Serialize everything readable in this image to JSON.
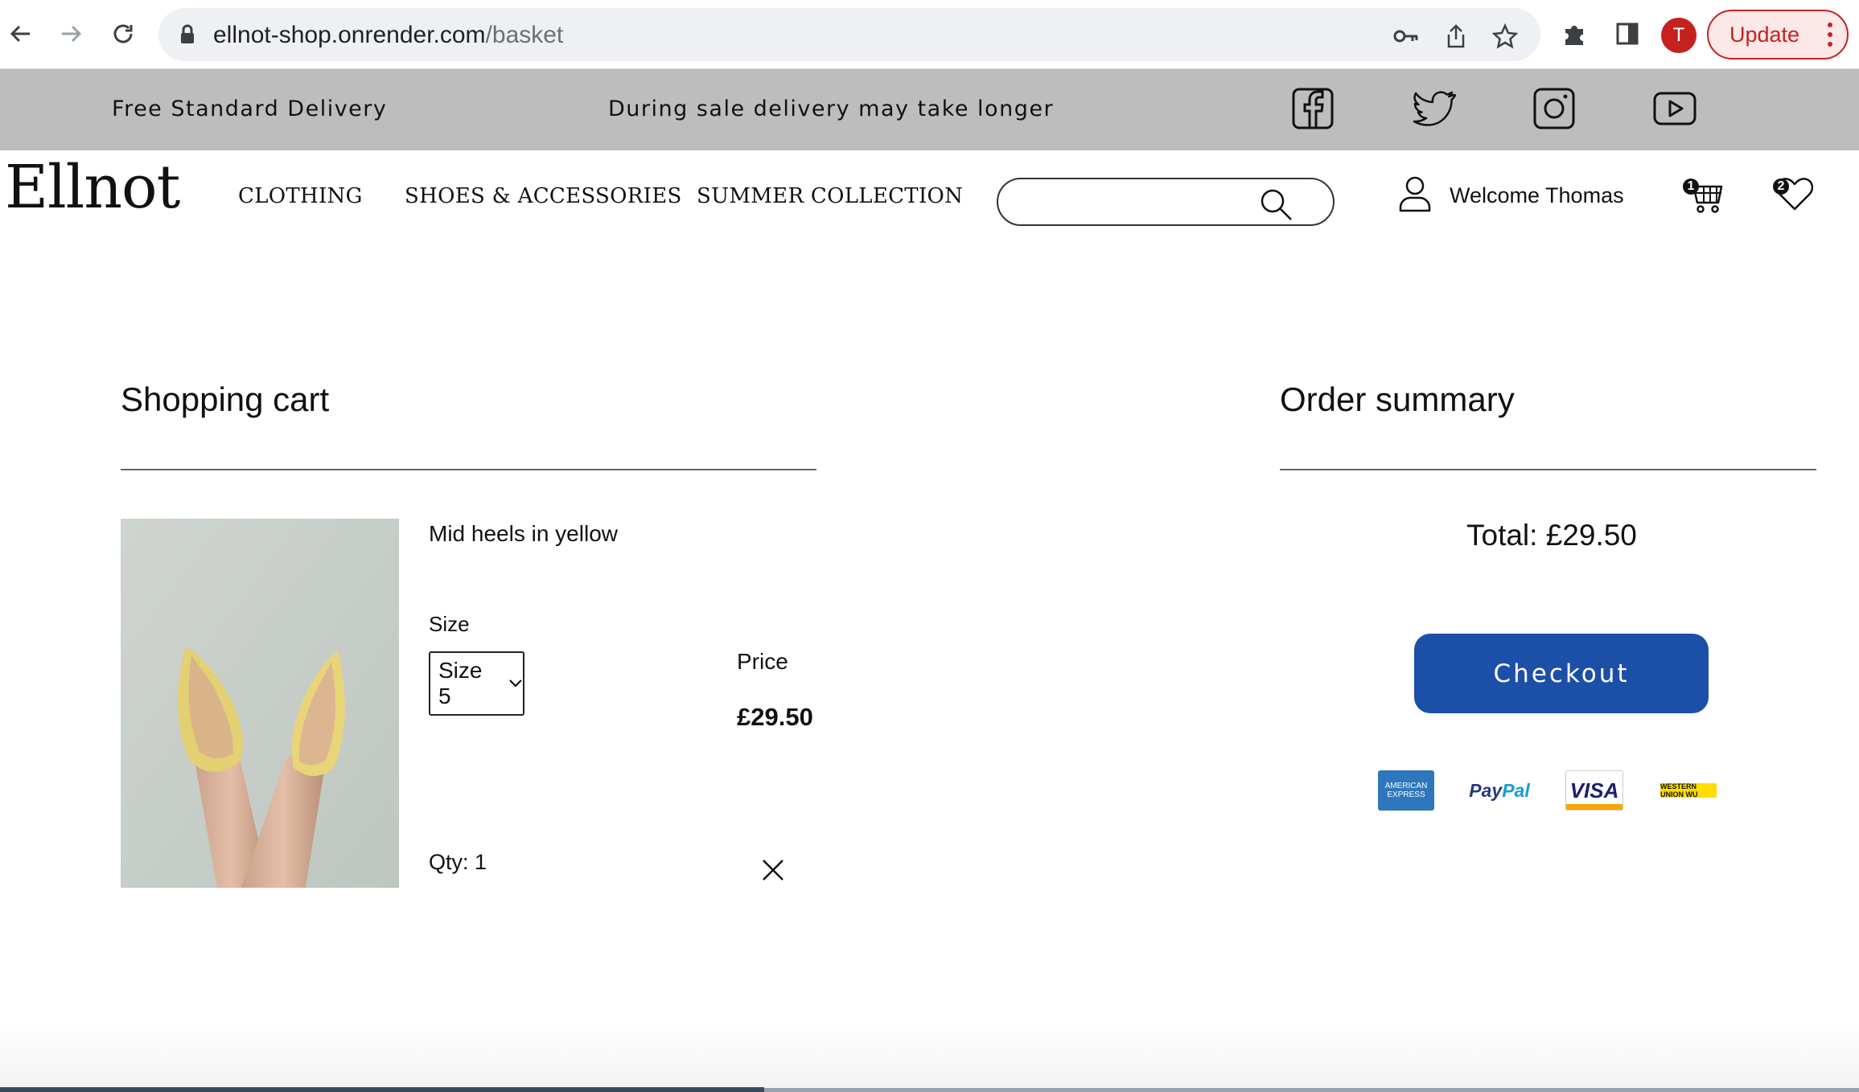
{
  "browser": {
    "url_host": "ellnot-shop.onrender.com",
    "url_path": "/basket",
    "avatar_letter": "T",
    "update_label": "Update"
  },
  "promo": {
    "delivery": "Free Standard Delivery",
    "notice": "During sale delivery may take longer"
  },
  "header": {
    "logo": "Ellnot",
    "nav": [
      "CLOTHING",
      "SHOES & ACCESSORIES",
      "SUMMER COLLECTION"
    ],
    "search_placeholder": "",
    "welcome": "Welcome Thomas",
    "cart_count": "1",
    "wishlist_count": "2"
  },
  "cart": {
    "title": "Shopping cart",
    "item": {
      "name": "Mid heels in yellow",
      "size_label": "Size",
      "size_value": "Size 5",
      "price_label": "Price",
      "price": "£29.50",
      "qty": "Qty: 1"
    }
  },
  "summary": {
    "title": "Order summary",
    "total": "Total: £29.50",
    "checkout_label": "Checkout",
    "payment_methods": {
      "amex": "AMERICAN EXPRESS",
      "paypal_a": "Pay",
      "paypal_b": "Pal",
      "visa": "VISA",
      "wu": "WESTERN UNION WU"
    }
  },
  "colors": {
    "promo_bar": "#bdbdbd",
    "checkout": "#1b4fa8",
    "update_accent": "#c5221f"
  }
}
